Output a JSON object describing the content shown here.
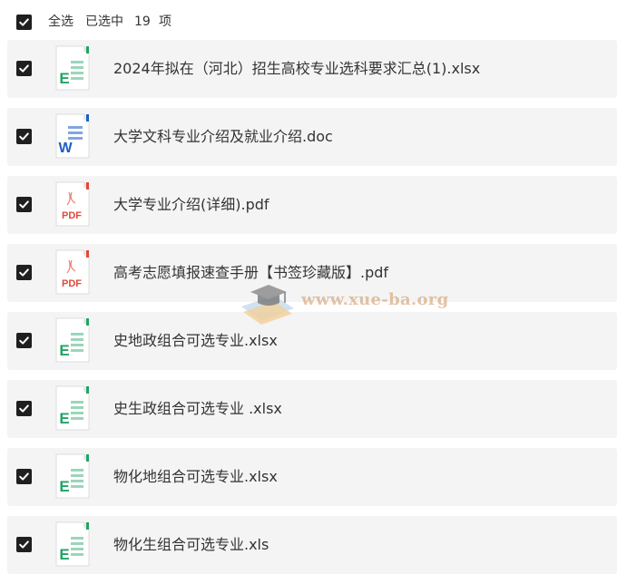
{
  "header": {
    "select_all_label": "全选",
    "selected_prefix": "已选中",
    "selected_count": "19",
    "selected_suffix": "项"
  },
  "files": [
    {
      "name": "2024年拟在（河北）招生高校专业选科要求汇总(1).xlsx",
      "type": "excel",
      "checked": true
    },
    {
      "name": "大学文科专业介绍及就业介绍.doc",
      "type": "word",
      "checked": true
    },
    {
      "name": "大学专业介绍(详细).pdf",
      "type": "pdf",
      "checked": true
    },
    {
      "name": "高考志愿填报速查手册【书签珍藏版】.pdf",
      "type": "pdf",
      "checked": true
    },
    {
      "name": "史地政组合可选专业.xlsx",
      "type": "excel",
      "checked": true
    },
    {
      "name": "史生政组合可选专业 .xlsx",
      "type": "excel",
      "checked": true
    },
    {
      "name": "物化地组合可选专业.xlsx",
      "type": "excel",
      "checked": true
    },
    {
      "name": "物化生组合可选专业.xls",
      "type": "excel",
      "checked": true
    }
  ],
  "icon_labels": {
    "excel": "E",
    "word": "W",
    "pdf": "PDF"
  },
  "watermark": {
    "text": "www.xue-ba.org"
  },
  "colors": {
    "excel": "#21a366",
    "word": "#1f5fc4",
    "pdf": "#e0483a",
    "row_bg": "#f4f4f4",
    "checkbox": "#1f1f1f"
  }
}
